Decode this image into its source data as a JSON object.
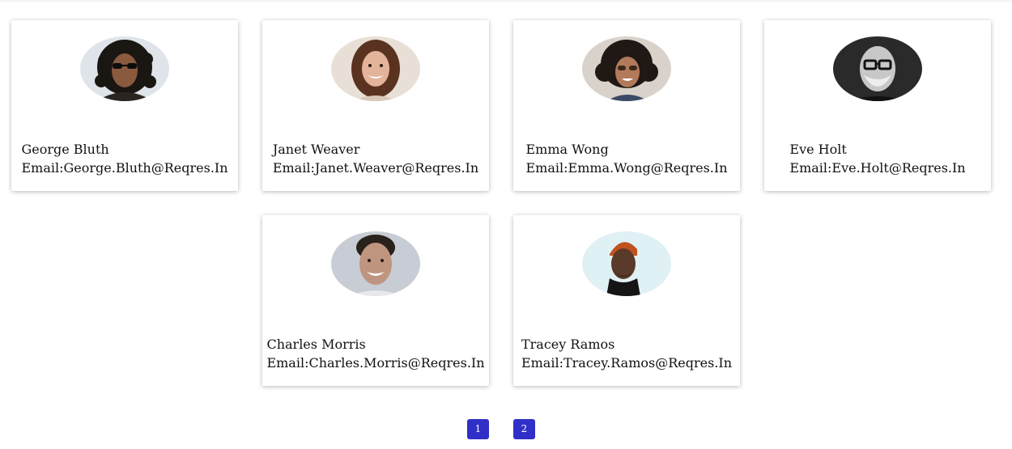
{
  "colors": {
    "accent": "#3030c8",
    "card_bg": "#ffffff",
    "text": "#111111"
  },
  "users": [
    {
      "name": "George Bluth",
      "email": "Email:George.Bluth@Reqres.In",
      "avatar_icon": "person-avatar-sunglasses"
    },
    {
      "name": "Janet Weaver",
      "email": "Email:Janet.Weaver@Reqres.In",
      "avatar_icon": "person-avatar-smiling"
    },
    {
      "name": "Emma Wong",
      "email": "Email:Emma.Wong@Reqres.In",
      "avatar_icon": "person-avatar-curly-hair"
    },
    {
      "name": "Eve Holt",
      "email": "Email:Eve.Holt@Reqres.In",
      "avatar_icon": "person-avatar-glasses-beard"
    },
    {
      "name": "Charles Morris",
      "email": "Email:Charles.Morris@Reqres.In",
      "avatar_icon": "person-avatar-smiling-man"
    },
    {
      "name": "Tracey Ramos",
      "email": "Email:Tracey.Ramos@Reqres.In",
      "avatar_icon": "person-avatar-beanie"
    }
  ],
  "pagination": {
    "pages": [
      "1",
      "2"
    ],
    "current": "1"
  }
}
